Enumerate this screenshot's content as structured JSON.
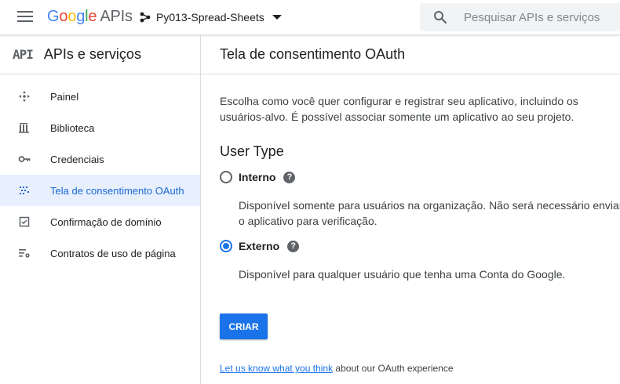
{
  "header": {
    "logo_google": [
      "G",
      "o",
      "o",
      "g",
      "l",
      "e"
    ],
    "logo_suffix": "APIs",
    "project_name": "Py013-Spread-Sheets",
    "search_placeholder": "Pesquisar APIs e serviços"
  },
  "sidebar": {
    "badge": "API",
    "title": "APIs e serviços",
    "items": [
      {
        "label": "Painel",
        "icon": "dashboard-icon"
      },
      {
        "label": "Biblioteca",
        "icon": "library-icon"
      },
      {
        "label": "Credenciais",
        "icon": "key-icon"
      },
      {
        "label": "Tela de consentimento OAuth",
        "icon": "consent-icon",
        "active": true
      },
      {
        "label": "Confirmação de domínio",
        "icon": "checkbox-icon"
      },
      {
        "label": "Contratos de uso de página",
        "icon": "settings-list-icon"
      }
    ]
  },
  "main": {
    "title": "Tela de consentimento OAuth",
    "intro": "Escolha como você quer configurar e registrar seu aplicativo, incluindo os usuários-alvo. É possível associar somente um aplicativo ao seu projeto.",
    "user_type_heading": "User Type",
    "options": [
      {
        "label": "Interno",
        "description": "Disponível somente para usuários na organização. Não será necessário enviar o aplicativo para verificação.",
        "checked": false
      },
      {
        "label": "Externo",
        "description": "Disponível para qualquer usuário que tenha uma Conta do Google.",
        "checked": true
      }
    ],
    "help_glyph": "?",
    "create_button": "CRIAR",
    "feedback_link": "Let us know what you think",
    "feedback_rest": " about our OAuth experience"
  },
  "colors": {
    "accent": "#1a73e8",
    "active_bg": "#e8f0fe"
  }
}
